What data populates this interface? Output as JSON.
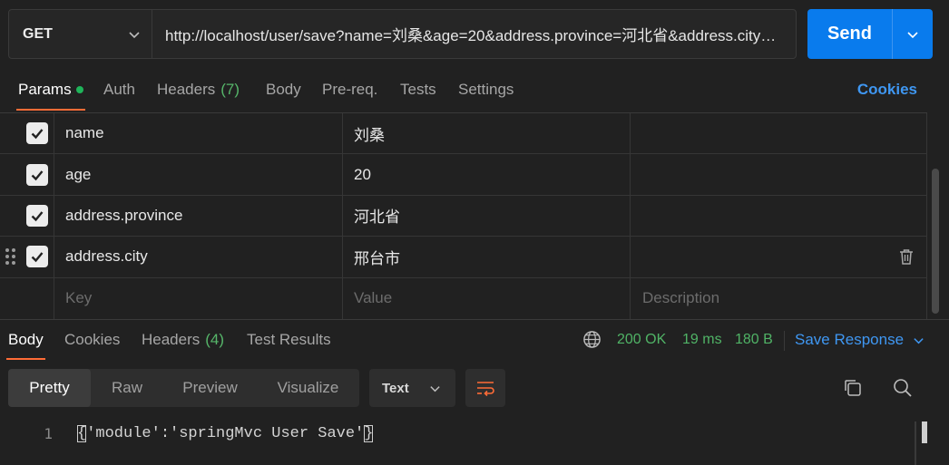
{
  "request": {
    "method": "GET",
    "url": "http://localhost/user/save?name=刘桑&age=20&address.province=河北省&address.city…",
    "send_label": "Send"
  },
  "request_tabs": {
    "params": "Params",
    "auth": "Auth",
    "headers": "Headers",
    "headers_count": "(7)",
    "body": "Body",
    "prereq": "Pre-req.",
    "tests": "Tests",
    "settings": "Settings",
    "cookies": "Cookies"
  },
  "params": {
    "rows": [
      {
        "key": "name",
        "value": "刘桑",
        "description": "",
        "checked": true
      },
      {
        "key": "age",
        "value": "20",
        "description": "",
        "checked": true
      },
      {
        "key": "address.province",
        "value": "河北省",
        "description": "",
        "checked": true
      },
      {
        "key": "address.city",
        "value": "邢台市",
        "description": "",
        "checked": true
      }
    ],
    "placeholder": {
      "key": "Key",
      "value": "Value",
      "description": "Description"
    }
  },
  "response_tabs": {
    "body": "Body",
    "cookies": "Cookies",
    "headers": "Headers",
    "headers_count": "(4)",
    "test_results": "Test Results"
  },
  "response_status": {
    "status": "200 OK",
    "time": "19 ms",
    "size": "180 B",
    "save_response": "Save Response"
  },
  "format_bar": {
    "pretty": "Pretty",
    "raw": "Raw",
    "preview": "Preview",
    "visualize": "Visualize",
    "type": "Text"
  },
  "code": {
    "line_number": "1",
    "open_brace": "{",
    "content": "'module':'springMvc User Save'",
    "close_brace": "}"
  },
  "colors": {
    "accent": "#ff6c37",
    "primary": "#097bed",
    "link": "#3f97f2",
    "success": "#50b366"
  },
  "icons": [
    "chevron-down-icon",
    "checkbox-icon",
    "drag-handle-icon",
    "trash-icon",
    "globe-icon",
    "wrap-lines-icon",
    "copy-icon",
    "search-icon"
  ]
}
